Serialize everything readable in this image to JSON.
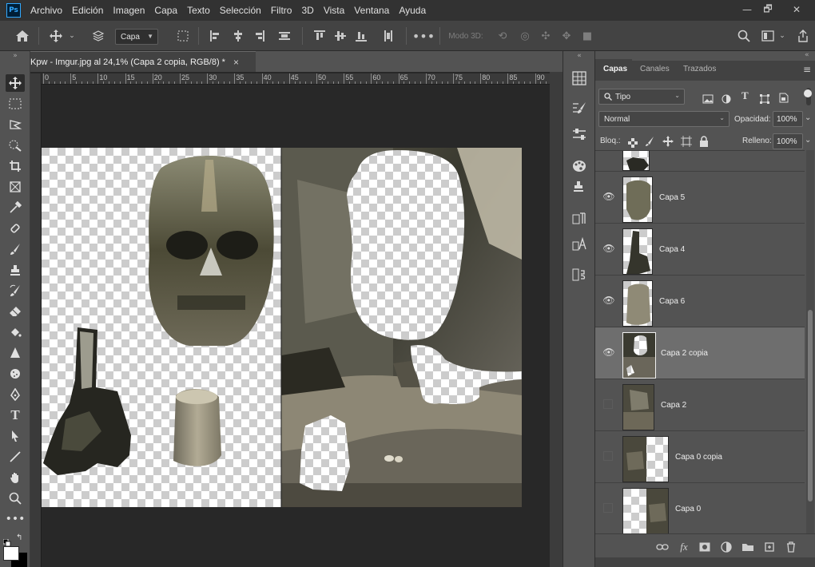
{
  "app": {
    "logo": "Ps"
  },
  "menu": [
    "Archivo",
    "Edición",
    "Imagen",
    "Capa",
    "Texto",
    "Selección",
    "Filtro",
    "3D",
    "Vista",
    "Ventana",
    "Ayuda"
  ],
  "window_controls": {
    "minimize": "—",
    "restore": "🗗",
    "close": "✕"
  },
  "options_bar": {
    "home_icon": "home-icon",
    "auto_select_value": "Capa",
    "mode_3d_label": "Modo 3D:"
  },
  "document": {
    "tab_title": "Kpw - Imgur.jpg al 24,1% (Capa 2 copia, RGB/8) *",
    "close_glyph": "×"
  },
  "ruler": {
    "ticks": [
      "0",
      "5",
      "10",
      "15",
      "20",
      "25",
      "30",
      "35",
      "40",
      "45",
      "50",
      "55",
      "60",
      "65",
      "70",
      "75",
      "80",
      "85",
      "90"
    ]
  },
  "layers_panel": {
    "tabs": [
      "Capas",
      "Canales",
      "Trazados"
    ],
    "filter_value": "Tipo",
    "blend_mode": "Normal",
    "opacity_label": "Opacidad:",
    "opacity_value": "100%",
    "lock_label": "Bloq.:",
    "fill_label": "Relleno:",
    "fill_value": "100%",
    "layers": [
      {
        "name": "Capa 5",
        "visible": true,
        "selected": false
      },
      {
        "name": "Capa 4",
        "visible": true,
        "selected": false
      },
      {
        "name": "Capa 6",
        "visible": true,
        "selected": false
      },
      {
        "name": "Capa 2 copia",
        "visible": true,
        "selected": true
      },
      {
        "name": "Capa 2",
        "visible": false,
        "selected": false
      },
      {
        "name": "Capa 0 copia",
        "visible": false,
        "selected": false
      },
      {
        "name": "Capa 0",
        "visible": false,
        "selected": false
      }
    ],
    "footer_fx": "fx"
  },
  "colors": {
    "menubar_bg": "#323232",
    "panel_bg": "#535353",
    "selected_layer": "#6e6e6e",
    "accent_blue": "#31a8ff",
    "foreground_swatch": "#000000",
    "background_swatch": "#ffffff"
  }
}
